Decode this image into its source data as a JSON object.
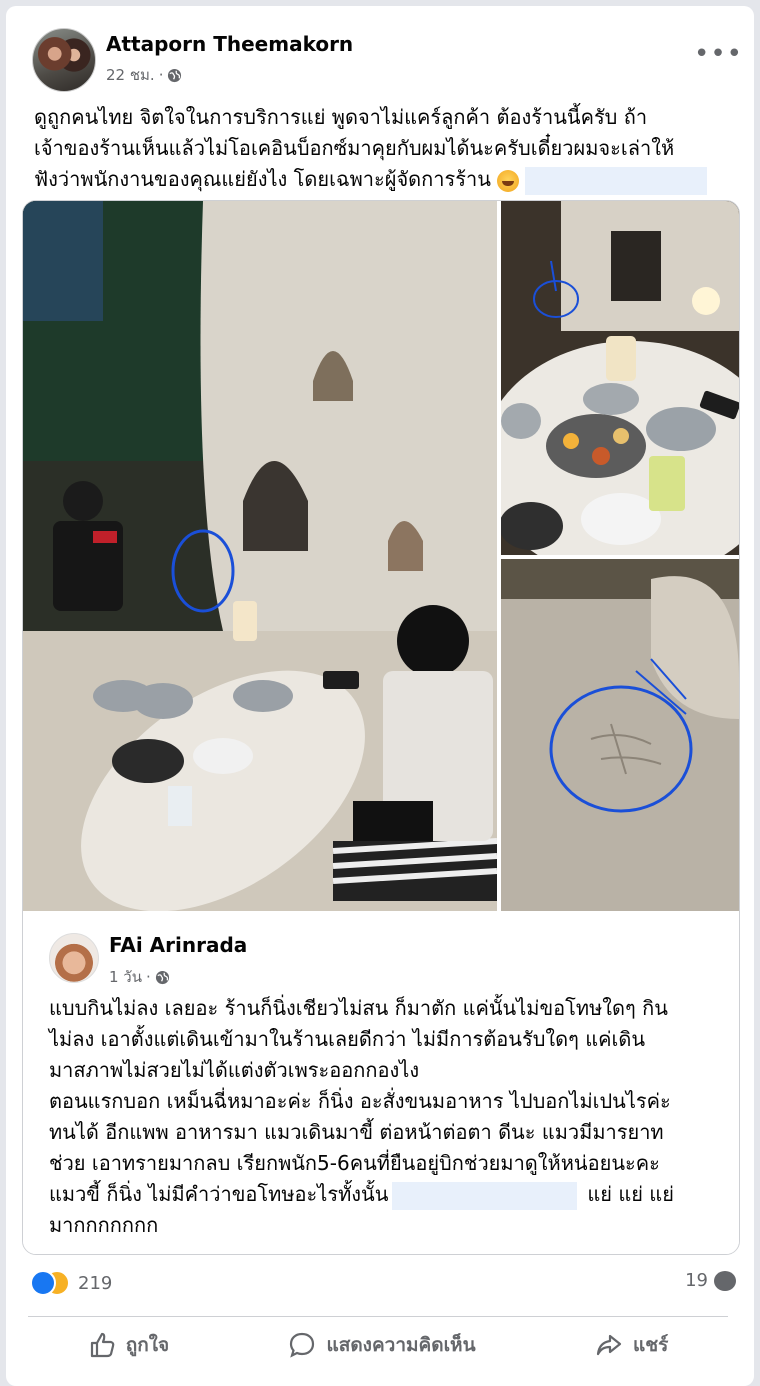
{
  "post": {
    "author": "Attaporn Theemakorn",
    "time": "22 ชม.",
    "text_lines": [
      "ดูถูกคนไทย จิตใจในการบริการแย่ พูดจาไม่แคร์ลูกค้า ต้องร้านนี้ครับ ถ้า",
      "เจ้าของร้านเห็นแล้วไม่โอเคอินบ็อกซ์มาคุยกับผมได้นะครับเดี๋ยวผมจะเล่าให้",
      "ฟังว่าพนักงานของคุณแย่ยังไง โดยเฉพาะผู้จัดการร้าน"
    ]
  },
  "shared_comment": {
    "author": "FAi Arinrada",
    "time": "1 วัน",
    "text_lines": [
      "แบบกินไม่ลง เลยอะ ร้านก็นิ่งเชียวไม่สน ก็มาตัก แค่นั้นไม่ขอโทษใดๆ กิน",
      "ไม่ลง  เอาตั้งแต่เดินเข้ามาในร้านเลยดีกว่า  ไม่มีการต้อนรับใดๆ แค่เดิน",
      "มาสภาพไม่สวยไม่ได้แต่งตัวเพระออกกองไง",
      "ตอนแรกบอก เหม็นฉี่หมาอะค่ะ ก็นิ่ง อะสั่งขนมอาหาร ไปบอกไม่เปนไรค่ะ",
      "ทนได้ อีกแพพ อาหารมา แมวเดินมาขี้ ต่อหน้าต่อตา ดีนะ แมวมีมารยาท",
      "ช่วย เอาทรายมากลบ เรียกพนัก5-6คนที่ยืนอยู่บิกช่วยมาดูให้หน่อยนะคะ",
      "แมวขี้ ก็นิ่ง ไม่มีคำว่าขอโทษอะไรทั้งนั้น",
      "แย่ แย่ แย่",
      "มากกกกกกก"
    ]
  },
  "footer": {
    "reaction_count": "219",
    "comment_count": "19",
    "like_label": "ถูกใจ",
    "comment_label": "แสดงความคิดเห็น",
    "share_label": "แชร์"
  },
  "colors": {
    "accent": "#1877f2",
    "muted": "#65676b",
    "annotation": "#1a4fd8"
  }
}
